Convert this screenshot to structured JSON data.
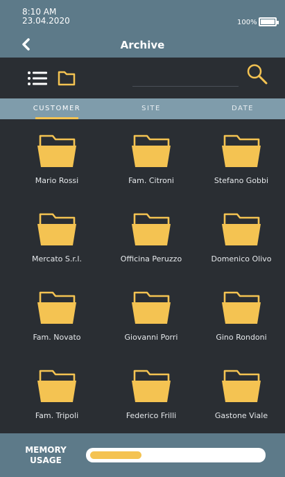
{
  "status": {
    "time": "8:10 AM",
    "date": "23.04.2020",
    "battery_percent": "100%",
    "battery_level": 1.0
  },
  "header": {
    "title": "Archive",
    "back_icon": "chevron-left-icon"
  },
  "toolbar": {
    "list_icon": "list-icon",
    "folder_icon": "folder-icon",
    "search_icon": "search-icon",
    "search_value": ""
  },
  "tabs": [
    {
      "label": "CUSTOMER",
      "active": true
    },
    {
      "label": "SITE",
      "active": false
    },
    {
      "label": "DATE",
      "active": false
    }
  ],
  "folders": [
    "Mario Rossi",
    "Fam. Citroni",
    "Stefano Gobbi",
    "Mercato S.r.l.",
    "Officina Peruzzo",
    "Domenico Olivo",
    "Fam. Novato",
    "Giovanni Porri",
    "Gino Rondoni",
    "Fam. Tripoli",
    "Federico Frilli",
    "Gastone Viale"
  ],
  "footer": {
    "memory_label_line1": "MEMORY",
    "memory_label_line2": "USAGE",
    "memory_usage_fraction": 0.3
  },
  "colors": {
    "accent": "#f4c352",
    "header_bg": "#5d7a89",
    "tab_bg": "#7f9cab",
    "content_bg": "#2a2e33"
  }
}
